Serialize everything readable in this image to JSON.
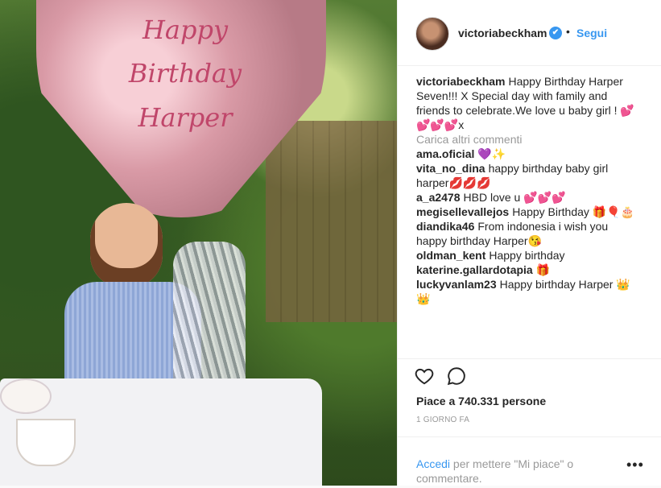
{
  "photo": {
    "balloon_text": [
      "Happy",
      "Birthday",
      "Harper"
    ]
  },
  "header": {
    "username": "victoriabeckham",
    "verified_mark": "✔",
    "separator": "•",
    "follow": "Segui"
  },
  "caption": {
    "username": "victoriabeckham",
    "text": "Happy Birthday Harper Seven!!! X Special day with family and friends to celebrate.We love u baby girl ! 💕💕💕💕x"
  },
  "load_more": "Carica altri commenti",
  "comments": [
    {
      "username": "ama.oficial",
      "text": "💜✨"
    },
    {
      "username": "vita_no_dina",
      "text": "happy birthday baby girl harper💋💋💋"
    },
    {
      "username": "a_a2478",
      "text": "HBD love u 💕💕💕"
    },
    {
      "username": "megisellevallejos",
      "text": "Happy Birthday 🎁🎈🎂"
    },
    {
      "username": "diandika46",
      "text": "From indonesia i wish you happy birthday Harper😘"
    },
    {
      "username": "oldman_kent",
      "text": "Happy birthday"
    },
    {
      "username": "katerine.gallardotapia",
      "text": "🎁"
    },
    {
      "username": "luckyvanlam23",
      "text": "Happy birthday Harper 👑👑"
    }
  ],
  "actions": {
    "likes": "Piace a 740.331 persone",
    "time": "1 GIORNO FA"
  },
  "login": {
    "link": "Accedi",
    "rest": " per mettere \"Mi piace\" o commentare.",
    "more": "•••"
  },
  "icons": {
    "like": "heart-outline-icon",
    "comment": "speech-bubble-icon",
    "more": "more-options-icon"
  },
  "colors": {
    "link": "#3897f0",
    "muted": "#999999",
    "text": "#262626"
  }
}
